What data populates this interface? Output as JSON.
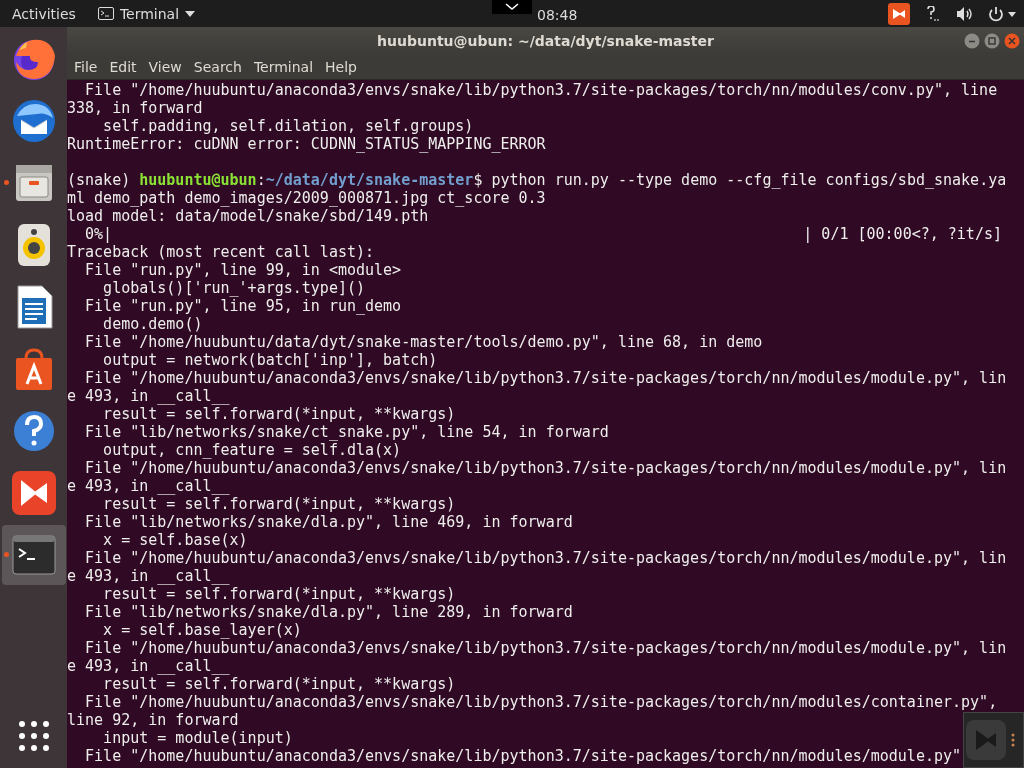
{
  "top_bar": {
    "activities": "Activities",
    "app_menu": "Terminal",
    "clock": "08:48"
  },
  "dock": [
    {
      "kind": "browser",
      "selected": false,
      "running": false
    },
    {
      "kind": "mail",
      "selected": false,
      "running": false
    },
    {
      "kind": "files",
      "selected": false,
      "running": true
    },
    {
      "kind": "music",
      "selected": false,
      "running": false
    },
    {
      "kind": "writer",
      "selected": false,
      "running": false
    },
    {
      "kind": "store",
      "selected": false,
      "running": false
    },
    {
      "kind": "help",
      "selected": false,
      "running": false
    },
    {
      "kind": "app",
      "selected": false,
      "running": false
    },
    {
      "kind": "terminal",
      "selected": true,
      "running": true
    }
  ],
  "window": {
    "title": "huubuntu@ubun: ~/data/dyt/snake-master"
  },
  "menu": [
    "File",
    "Edit",
    "View",
    "Search",
    "Terminal",
    "Help"
  ],
  "lines": [
    {
      "kind": "text",
      "text": "  File \"/home/huubuntu/anaconda3/envs/snake/lib/python3.7/site-packages/torch/nn/modules/conv.py\", line"
    },
    {
      "kind": "text",
      "text": "338, in forward"
    },
    {
      "kind": "text",
      "text": "    self.padding, self.dilation, self.groups)"
    },
    {
      "kind": "text",
      "text": "RuntimeError: cuDNN error: CUDNN_STATUS_MAPPING_ERROR"
    },
    {
      "kind": "blank"
    },
    {
      "kind": "prompt",
      "env": "(snake) ",
      "user": "huubuntu@ubun",
      "sep": ":",
      "path": "~/data/dyt/snake-master",
      "command": "$ python run.py --type demo --cfg_file configs/sbd_snake.ya"
    },
    {
      "kind": "text",
      "text": "ml demo_path demo_images/2009_000871.jpg ct_score 0.3"
    },
    {
      "kind": "text",
      "text": "load model: data/model/snake/sbd/149.pth"
    },
    {
      "kind": "progress",
      "left": "  0%|",
      "right": "| 0/1 [00:00<?, ?it/s]"
    },
    {
      "kind": "text",
      "text": "Traceback (most recent call last):"
    },
    {
      "kind": "text",
      "text": "  File \"run.py\", line 99, in <module>"
    },
    {
      "kind": "text",
      "text": "    globals()['run_'+args.type]()"
    },
    {
      "kind": "text",
      "text": "  File \"run.py\", line 95, in run_demo"
    },
    {
      "kind": "text",
      "text": "    demo.demo()"
    },
    {
      "kind": "text",
      "text": "  File \"/home/huubuntu/data/dyt/snake-master/tools/demo.py\", line 68, in demo"
    },
    {
      "kind": "text",
      "text": "    output = network(batch['inp'], batch)"
    },
    {
      "kind": "text",
      "text": "  File \"/home/huubuntu/anaconda3/envs/snake/lib/python3.7/site-packages/torch/nn/modules/module.py\", lin"
    },
    {
      "kind": "text",
      "text": "e 493, in __call__"
    },
    {
      "kind": "text",
      "text": "    result = self.forward(*input, **kwargs)"
    },
    {
      "kind": "text",
      "text": "  File \"lib/networks/snake/ct_snake.py\", line 54, in forward"
    },
    {
      "kind": "text",
      "text": "    output, cnn_feature = self.dla(x)"
    },
    {
      "kind": "text",
      "text": "  File \"/home/huubuntu/anaconda3/envs/snake/lib/python3.7/site-packages/torch/nn/modules/module.py\", lin"
    },
    {
      "kind": "text",
      "text": "e 493, in __call__"
    },
    {
      "kind": "text",
      "text": "    result = self.forward(*input, **kwargs)"
    },
    {
      "kind": "text",
      "text": "  File \"lib/networks/snake/dla.py\", line 469, in forward"
    },
    {
      "kind": "text",
      "text": "    x = self.base(x)"
    },
    {
      "kind": "text",
      "text": "  File \"/home/huubuntu/anaconda3/envs/snake/lib/python3.7/site-packages/torch/nn/modules/module.py\", lin"
    },
    {
      "kind": "text",
      "text": "e 493, in __call__"
    },
    {
      "kind": "text",
      "text": "    result = self.forward(*input, **kwargs)"
    },
    {
      "kind": "text",
      "text": "  File \"lib/networks/snake/dla.py\", line 289, in forward"
    },
    {
      "kind": "text",
      "text": "    x = self.base_layer(x)"
    },
    {
      "kind": "text",
      "text": "  File \"/home/huubuntu/anaconda3/envs/snake/lib/python3.7/site-packages/torch/nn/modules/module.py\", lin"
    },
    {
      "kind": "text",
      "text": "e 493, in __call__"
    },
    {
      "kind": "text",
      "text": "    result = self.forward(*input, **kwargs)"
    },
    {
      "kind": "text",
      "text": "  File \"/home/huubuntu/anaconda3/envs/snake/lib/python3.7/site-packages/torch/nn/modules/container.py\","
    },
    {
      "kind": "text",
      "text": "line 92, in forward"
    },
    {
      "kind": "text",
      "text": "    input = module(input)"
    },
    {
      "kind": "text",
      "text": "  File \"/home/huubuntu/anaconda3/envs/snake/lib/python3.7/site-packages/torch/nn/modules/module.py\""
    }
  ]
}
